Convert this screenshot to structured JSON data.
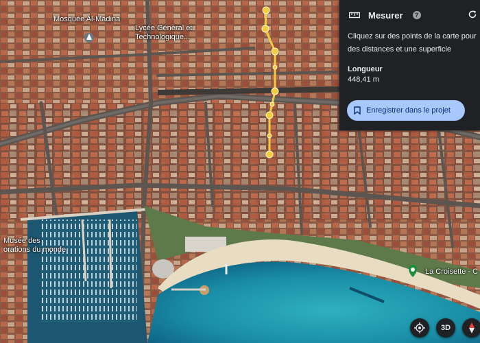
{
  "map": {
    "labels": {
      "mosque": "Mosquée Al-Madina",
      "lycee_line1": "Lycée Général et",
      "lycee_line2": "Technologique...",
      "musee_line1": "Musée des",
      "musee_line2": "orations du monde",
      "croisette": "La Croisette - C"
    },
    "icons": {
      "mosque_pin": "place-of-worship-icon",
      "croisette_pin": "landmark-pin-icon"
    },
    "route_color": "#f2cc3f"
  },
  "panel": {
    "title": "Mesurer",
    "ruler_icon": "ruler-icon",
    "help_icon": "help-icon",
    "help_glyph": "?",
    "reset_icon": "refresh-icon",
    "instructions_line1": "Cliquez sur des points de la carte pour",
    "instructions_line2": "des distances et une superficie",
    "length_label": "Longueur",
    "length_value": "448,41 m",
    "save_label": "Enregistrer dans le projet",
    "save_icon": "bookmark-icon"
  },
  "controls": {
    "location_icon": "my-location-icon",
    "view3d_label": "3D",
    "compass_icon": "compass-icon"
  }
}
